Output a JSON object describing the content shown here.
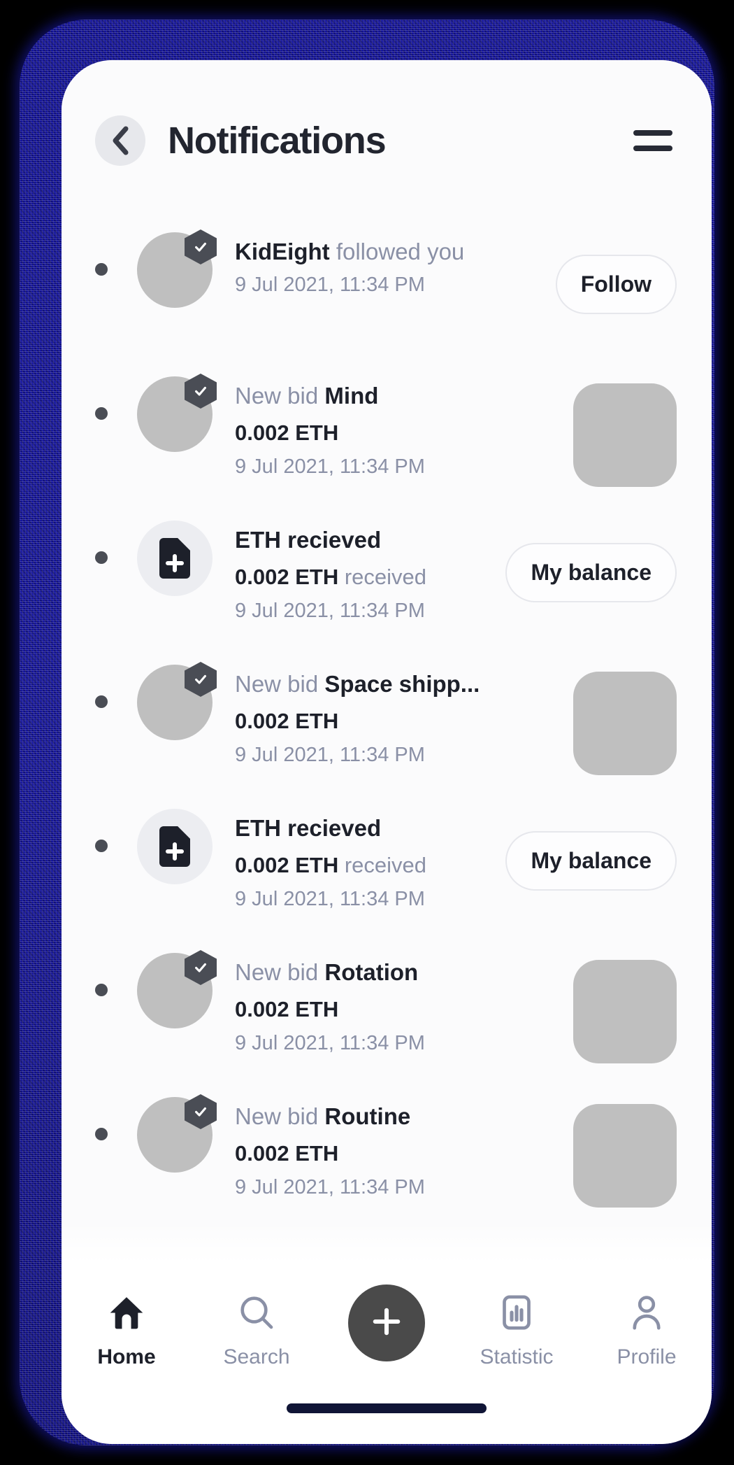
{
  "header": {
    "title": "Notifications",
    "back_icon": "chevron-left-icon",
    "menu_icon": "hamburger-menu-icon"
  },
  "notifications": [
    {
      "kind": "follow",
      "icon": "avatar-verified",
      "line1_muted_before": "",
      "line1_strong": "KidEight",
      "line1_muted_after": "followed you",
      "amount": "",
      "currency": "",
      "amount_suffix": "",
      "time": "9 Jul 2021, 11:34 PM",
      "action_label": "Follow",
      "has_thumb": false
    },
    {
      "kind": "bid",
      "icon": "avatar-verified",
      "line1_muted_before": "New bid",
      "line1_strong": "Mind",
      "line1_muted_after": "",
      "amount": "0.002",
      "currency": "ETH",
      "amount_suffix": "",
      "time": "9 Jul 2021, 11:34 PM",
      "action_label": "",
      "has_thumb": true
    },
    {
      "kind": "received",
      "icon": "document-plus-icon",
      "line1_muted_before": "",
      "line1_strong": "ETH recieved",
      "line1_muted_after": "",
      "amount": "0.002",
      "currency": "ETH",
      "amount_suffix": "received",
      "time": "9 Jul 2021, 11:34 PM",
      "action_label": "My balance",
      "has_thumb": false
    },
    {
      "kind": "bid",
      "icon": "avatar-verified",
      "line1_muted_before": "New bid",
      "line1_strong": "Space shipp...",
      "line1_muted_after": "",
      "amount": "0.002",
      "currency": "ETH",
      "amount_suffix": "",
      "time": "9 Jul 2021, 11:34 PM",
      "action_label": "",
      "has_thumb": true
    },
    {
      "kind": "received",
      "icon": "document-plus-icon",
      "line1_muted_before": "",
      "line1_strong": "ETH recieved",
      "line1_muted_after": "",
      "amount": "0.002",
      "currency": "ETH",
      "amount_suffix": "received",
      "time": "9 Jul 2021, 11:34 PM",
      "action_label": "My balance",
      "has_thumb": false
    },
    {
      "kind": "bid",
      "icon": "avatar-verified",
      "line1_muted_before": "New bid",
      "line1_strong": "Rotation",
      "line1_muted_after": "",
      "amount": "0.002",
      "currency": "ETH",
      "amount_suffix": "",
      "time": "9 Jul 2021, 11:34 PM",
      "action_label": "",
      "has_thumb": true
    },
    {
      "kind": "bid",
      "icon": "avatar-verified",
      "line1_muted_before": "New bid",
      "line1_strong": "Routine",
      "line1_muted_after": "",
      "amount": "0.002",
      "currency": "ETH",
      "amount_suffix": "",
      "time": "9 Jul 2021, 11:34 PM",
      "action_label": "",
      "has_thumb": true
    }
  ],
  "bottom_nav": {
    "items": [
      {
        "label": "Home",
        "icon": "home-icon",
        "active": true
      },
      {
        "label": "Search",
        "icon": "search-icon",
        "active": false
      },
      {
        "label": "Statistic",
        "icon": "statistic-icon",
        "active": false
      },
      {
        "label": "Profile",
        "icon": "profile-icon",
        "active": false
      }
    ],
    "fab_icon": "plus-icon"
  },
  "colors": {
    "frame": "#1414a0",
    "screen_bg": "#fbfbfc",
    "text_dark": "#1d202a",
    "text_muted": "#8a90a6",
    "avatar_gray": "#bfbfbf",
    "fab": "#4a4a4a",
    "home_indicator": "#101536"
  }
}
